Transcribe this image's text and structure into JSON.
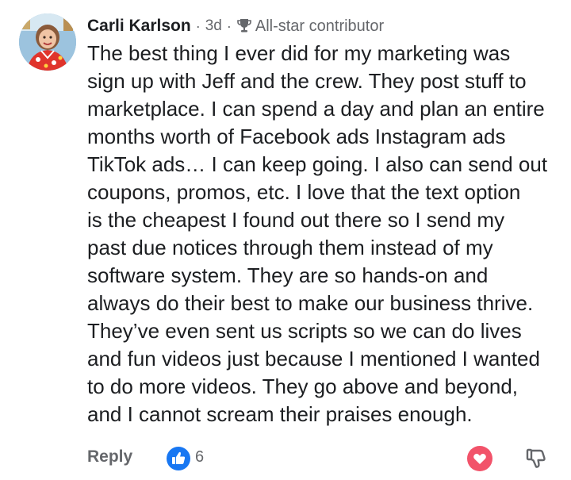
{
  "comment": {
    "author": "Carli Karlson",
    "separator": "·",
    "time": "3d",
    "separator2": "·",
    "badge_icon": "trophy-icon",
    "badge_label": "All-star contributor",
    "text": "The best thing I ever did for my marketing was\nsign up with Jeff and the crew. They post stuff to\nmarketplace. I can spend a day and plan an entire\nmonths worth of Facebook ads Instagram ads\nTikTok ads… I can keep going. I also can send out\ncoupons, promos, etc. I love that the text option\nis the cheapest I found out there so I send my\npast due notices through them instead of my\nsoftware system. They are so hands-on and\nalways do their best to make our business thrive.\nThey’ve even sent us scripts so we can do lives\nand fun videos just because I mentioned I wanted\nto do more videos. They go above and beyond,\nand I cannot scream their praises enough."
  },
  "actions": {
    "reply_label": "Reply",
    "like_icon": "thumbs-up-icon",
    "like_count": "6",
    "love_icon": "heart-icon",
    "dislike_icon": "thumbs-down-icon"
  },
  "colors": {
    "like": "#1877f2",
    "love": "#f2536a",
    "secondary_text": "#65676b",
    "primary_text": "#1c1e21"
  }
}
